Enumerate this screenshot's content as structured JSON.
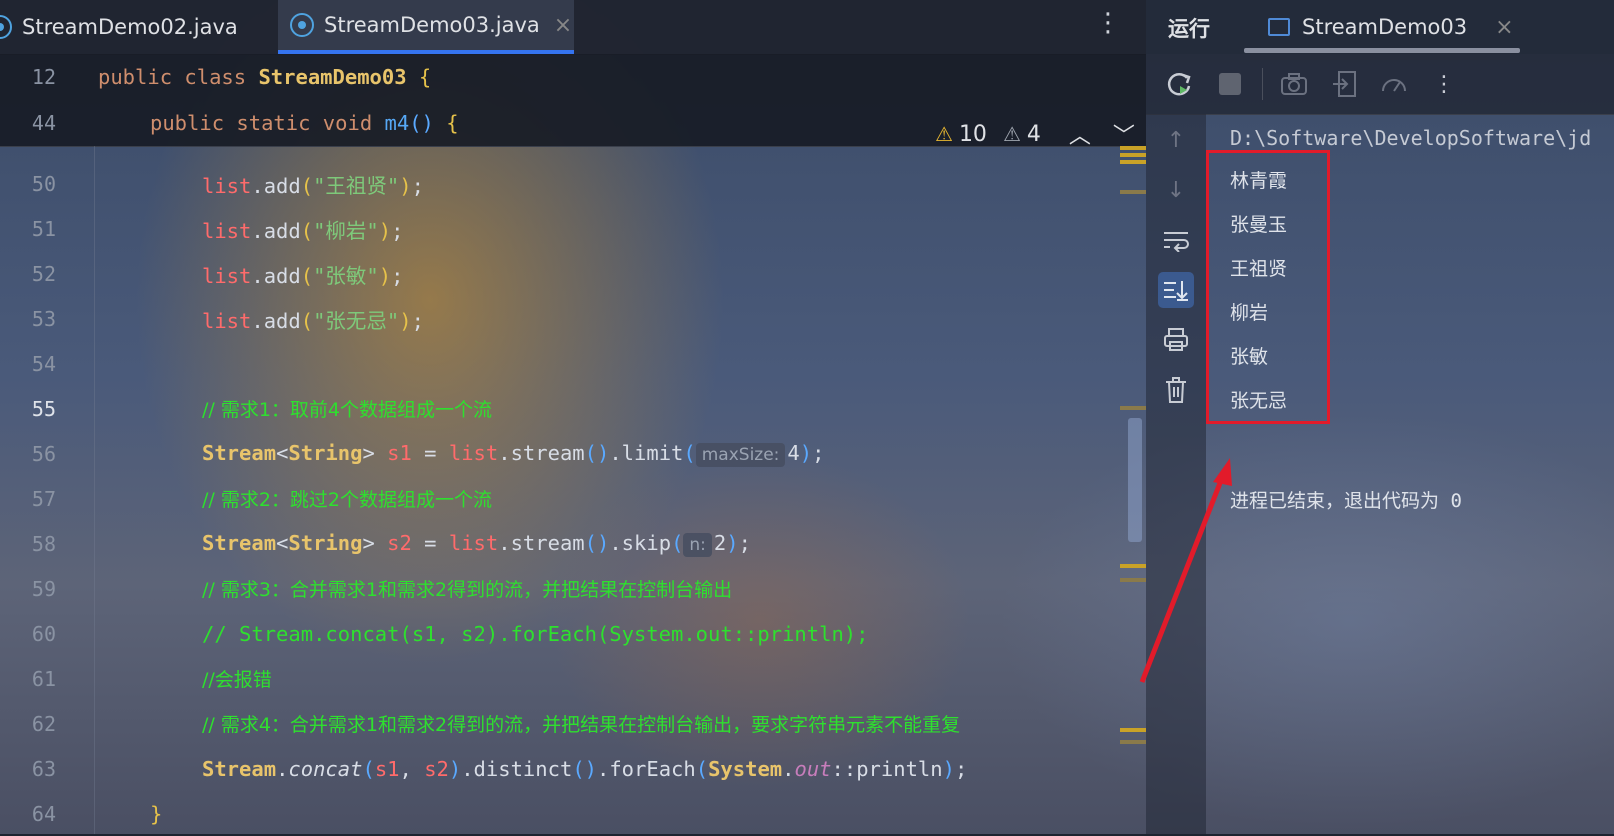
{
  "editor": {
    "tabs": [
      {
        "label": "StreamDemo02.java",
        "active": false
      },
      {
        "label": "StreamDemo03.java",
        "active": true,
        "close": "×"
      }
    ],
    "more_menu": "⋮",
    "inspections": {
      "warnings": "10",
      "weak_warnings": "4"
    },
    "sticky": [
      {
        "num": "12",
        "code": "public class StreamDemo03 {"
      },
      {
        "num": "44",
        "code": "public static void m4() {"
      }
    ],
    "lines": [
      {
        "num": "50",
        "str": "\"王祖贤\""
      },
      {
        "num": "51",
        "str": "\"柳岩\""
      },
      {
        "num": "52",
        "str": "\"张敏\""
      },
      {
        "num": "53",
        "str": "\"张无忌\""
      },
      {
        "num": "54"
      },
      {
        "num": "55",
        "comment": "// 需求1：取前4个数据组成一个流"
      },
      {
        "num": "56",
        "hint": "maxSize:",
        "arg": "4"
      },
      {
        "num": "57",
        "comment": "// 需求2：跳过2个数据组成一个流"
      },
      {
        "num": "58",
        "hint": "n:",
        "arg": "2"
      },
      {
        "num": "59",
        "comment": "// 需求3：合并需求1和需求2得到的流，并把结果在控制台输出"
      },
      {
        "num": "60",
        "comment": "// Stream.concat(s1, s2).forEach(System.out::println);"
      },
      {
        "num": "61",
        "comment": "//会报错"
      },
      {
        "num": "62",
        "comment": "// 需求4：合并需求1和需求2得到的流，并把结果在控制台输出，要求字符串元素不能重复"
      },
      {
        "num": "63"
      },
      {
        "num": "64",
        "code": "}"
      }
    ]
  },
  "run": {
    "title": "运行",
    "tab": "StreamDemo03",
    "tab_close": "×",
    "command": "D:\\Software\\DevelopSoftware\\jd",
    "output": [
      "林青霞",
      "张曼玉",
      "王祖贤",
      "柳岩",
      "张敏",
      "张无忌"
    ],
    "exit_message": "进程已结束，退出代码为 0"
  },
  "colors": {
    "accent": "#3574f0",
    "highlight_box": "#e21b2a",
    "comment": "#2ee02e"
  }
}
